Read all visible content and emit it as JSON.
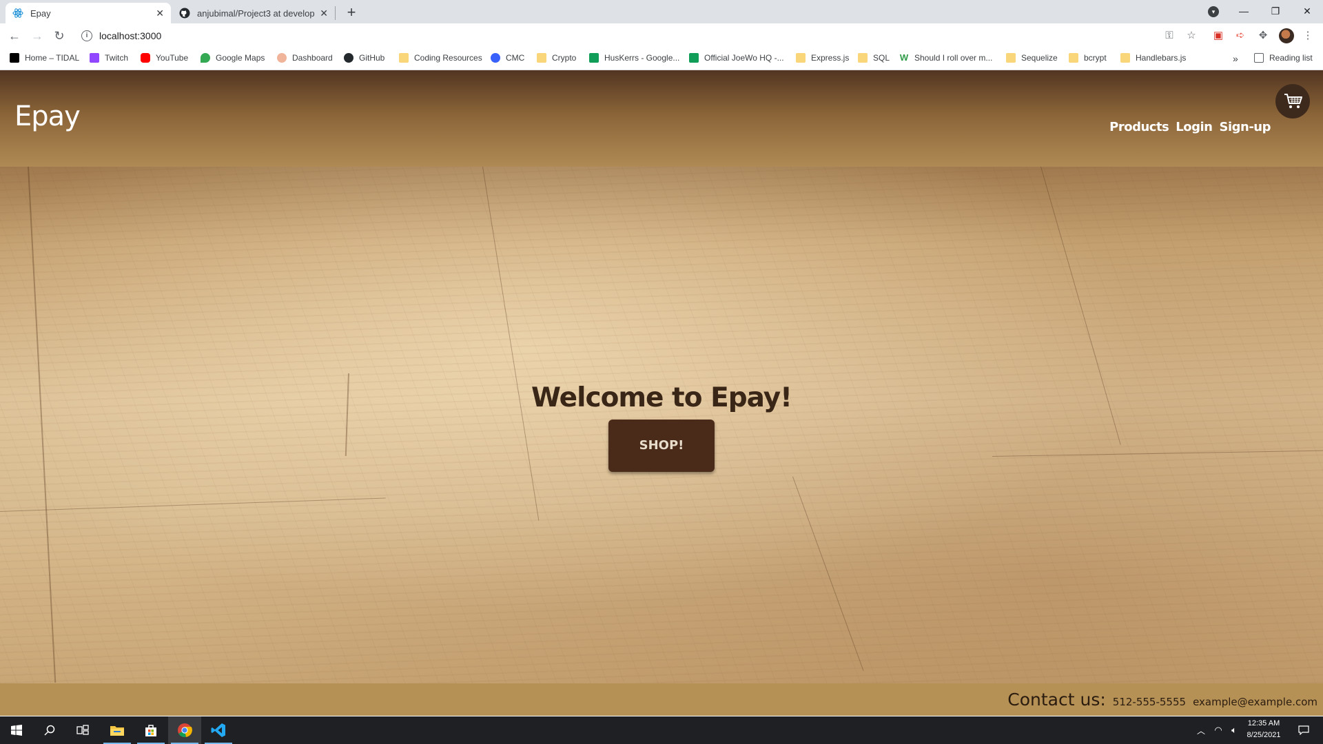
{
  "browser": {
    "tabs": [
      {
        "title": "Epay",
        "active": true,
        "favicon": "react-icon"
      },
      {
        "title": "anjubimal/Project3 at develop",
        "active": false,
        "favicon": "github-icon"
      }
    ],
    "url": "localhost:3000",
    "bookmarks": [
      {
        "label": "Home – TIDAL",
        "icon": "tidal-icon"
      },
      {
        "label": "Twitch",
        "icon": "twitch-icon"
      },
      {
        "label": "YouTube",
        "icon": "youtube-icon"
      },
      {
        "label": "Google Maps",
        "icon": "maps-icon"
      },
      {
        "label": "Dashboard",
        "icon": "dashboard-icon"
      },
      {
        "label": "GitHub",
        "icon": "github-icon"
      },
      {
        "label": "Coding Resources",
        "icon": "folder-icon"
      },
      {
        "label": "CMC",
        "icon": "cmc-icon"
      },
      {
        "label": "Crypto",
        "icon": "folder-icon"
      },
      {
        "label": "HusKerrs - Google...",
        "icon": "sheets-icon"
      },
      {
        "label": "Official JoeWo HQ -...",
        "icon": "sheets-icon"
      },
      {
        "label": "Express.js",
        "icon": "folder-icon"
      },
      {
        "label": "SQL",
        "icon": "folder-icon"
      },
      {
        "label": "Should I roll over m...",
        "icon": "w-icon"
      },
      {
        "label": "Sequelize",
        "icon": "folder-icon"
      },
      {
        "label": "bcrypt",
        "icon": "folder-icon"
      },
      {
        "label": "Handlebars.js",
        "icon": "folder-icon"
      }
    ],
    "bookmarks_overflow": "»",
    "reading_list": "Reading list"
  },
  "site": {
    "brand": "Epay",
    "nav": {
      "products": "Products",
      "login": "Login",
      "signup": "Sign-up"
    },
    "hero": {
      "welcome": "Welcome to Epay!",
      "shop_button": "SHOP!"
    },
    "footer": {
      "contact_label": "Contact us:",
      "phone": "512-555-5555",
      "email": "example@example.com"
    }
  },
  "taskbar": {
    "time": "12:35 AM",
    "date": "8/25/2021"
  },
  "colors": {
    "header_dark": "#523521",
    "header_light": "#b08a54",
    "footer": "#b69155",
    "button": "#4a2a18",
    "welcome_text": "#3a2617"
  }
}
